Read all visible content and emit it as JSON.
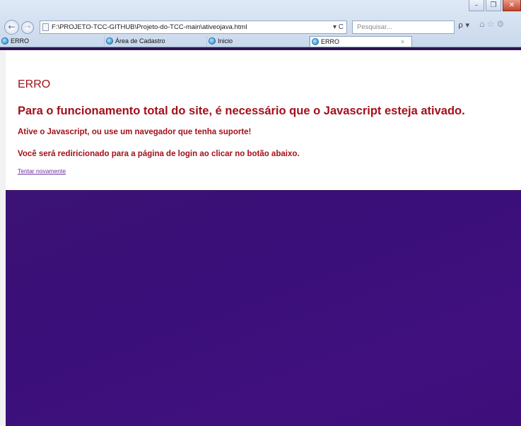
{
  "browser": {
    "address": "F:\\PROJETO-TCC-GITHUB\\Projeto-do-TCC-main\\ativeojava.html",
    "address_tools": "▾ C",
    "search_placeholder": "Pesquisar...",
    "search_go": "ρ ▾",
    "tabs": [
      {
        "label": "ERRO"
      },
      {
        "label": "Área de Cadastro"
      },
      {
        "label": "Inicio"
      },
      {
        "label": "ERRO"
      }
    ],
    "tab_close": "×",
    "icons": {
      "back": "back-arrow-icon",
      "forward": "forward-arrow-icon",
      "home": "home-icon",
      "favorites": "star-icon",
      "tools": "gear-icon"
    }
  },
  "page": {
    "title": "ERRO",
    "message_main": "Para o funcionamento total do site, é necessário que o Javascript esteja ativado.",
    "message_sub": "Ative o Javascript, ou use um navegador que tenha suporte!",
    "message_redirect": "Você será rediricionado para a página de login ao clicar no botão abaixo.",
    "retry_link": "Tentar novamente"
  },
  "colors": {
    "error_text": "#a3101a",
    "background_purple": "#3b1275",
    "link": "#6b2fa1"
  }
}
